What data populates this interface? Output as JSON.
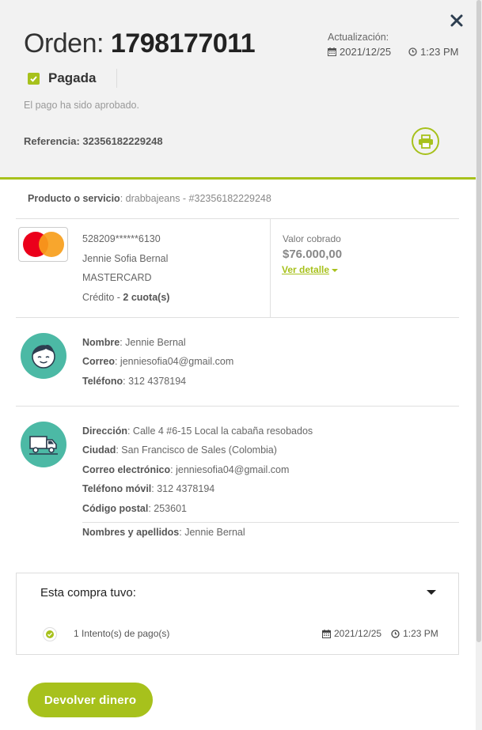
{
  "header": {
    "order_prefix": "Orden: ",
    "order_number": "1798177011",
    "update_label": "Actualización:",
    "update_date": "2021/12/25",
    "update_time": "1:23 PM",
    "status_label": "Pagada",
    "status_message": "El pago ha sido aprobado.",
    "reference": "Referencia: 32356182229248"
  },
  "product": {
    "label": "Producto o servicio",
    "value": ": drabbajeans - #32356182229248"
  },
  "payment": {
    "card_number": "528209******6130",
    "holder": "Jennie Sofia Bernal",
    "brand": "MASTERCARD",
    "type_prefix": "Crédito - ",
    "installments": "2 cuota(s)",
    "amount_label": "Valor cobrado",
    "amount": "$76.000,00",
    "detail_link": "Ver detalle"
  },
  "customer": {
    "name_label": "Nombre",
    "name": ": Jennie Bernal",
    "email_label": "Correo",
    "email": ": jenniesofia04@gmail.com",
    "phone_label": "Teléfono",
    "phone": ": 312 4378194"
  },
  "shipping": {
    "address_label": "Dirección",
    "address": ": Calle 4 #6-15 Local la cabaña resobados",
    "city_label": "Ciudad",
    "city": ": San Francisco de Sales (Colombia)",
    "email_label": "Correo electrónico",
    "email": ": jenniesofia04@gmail.com",
    "mobile_label": "Teléfono móvil",
    "mobile": ": 312 4378194",
    "postal_label": "Código postal",
    "postal": ": 253601",
    "fullname_label": "Nombres y apellidos",
    "fullname": ": Jennie Bernal"
  },
  "summary": {
    "title": "Esta compra tuvo",
    "title_suffix": ":",
    "attempts": "1 Intento(s) de pago(s)",
    "date": "2021/12/25",
    "time": "1:23 PM"
  },
  "actions": {
    "refund": "Devolver dinero"
  },
  "colors": {
    "accent": "#a7c11c",
    "avatar_bg": "#4cb9a5",
    "header_bg": "#f2f2f2"
  }
}
